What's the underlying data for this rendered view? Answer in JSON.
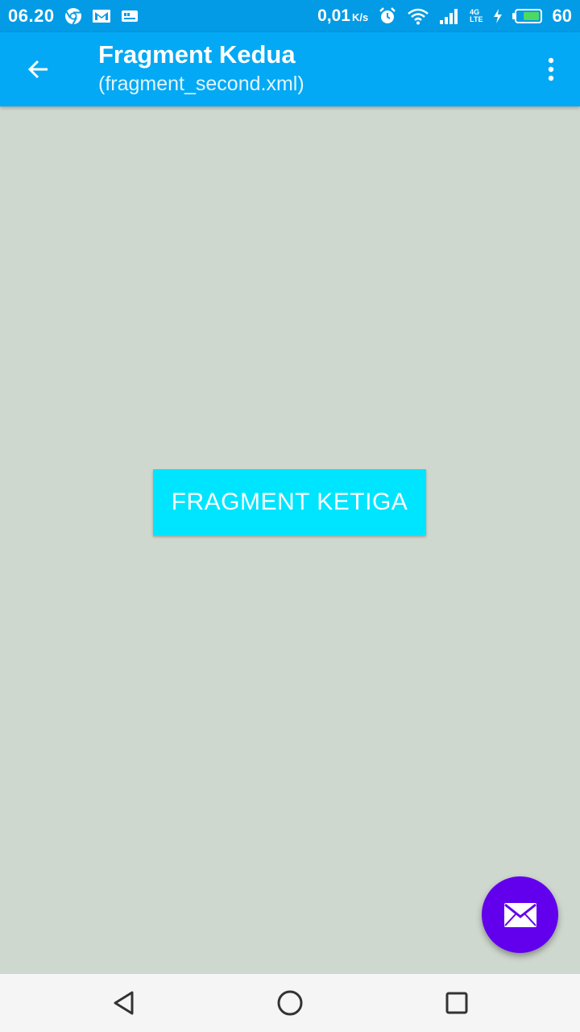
{
  "status_bar": {
    "time": "06.20",
    "speed_value": "0,01",
    "speed_unit": "K/s",
    "network_top": "4G",
    "network_bottom": "LTE",
    "battery_level": "60",
    "icons": [
      "chrome-icon",
      "gmail-icon",
      "sd-card-icon",
      "alarm-icon",
      "wifi-icon",
      "signal-icon",
      "charging-icon",
      "battery-icon"
    ]
  },
  "app_bar": {
    "title": "Fragment Kedua",
    "subtitle": "(fragment_second.xml)",
    "back_icon": "arrow-back-icon",
    "menu_icon": "more-vert-icon"
  },
  "main": {
    "button_label": "FRAGMENT KETIGA",
    "fab_icon": "email-icon"
  },
  "nav_bar": {
    "buttons": [
      "back",
      "home",
      "recents"
    ]
  },
  "colors": {
    "status_bar": "#039BE5",
    "app_bar": "#03A9F4",
    "content_bg": "#CFD8CE",
    "button_bg": "#00E5FF",
    "fab_bg": "#6200EE",
    "nav_bg": "#F5F5F5"
  }
}
